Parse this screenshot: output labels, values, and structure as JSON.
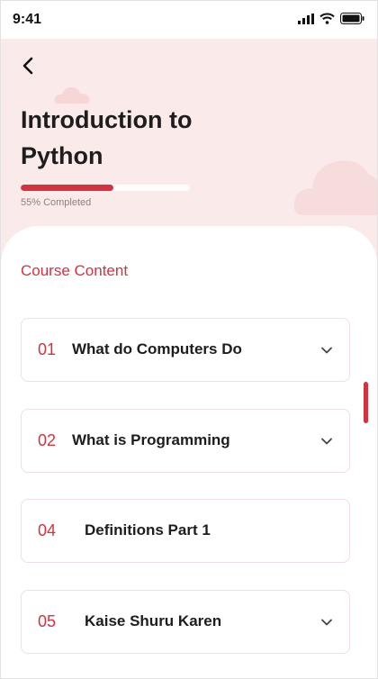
{
  "status": {
    "time": "9:41"
  },
  "course": {
    "title": "Introduction to Python",
    "progress_percent": 55,
    "progress_label": "55% Completed"
  },
  "content": {
    "section_title": "Course Content",
    "items": [
      {
        "number": "01",
        "label": "What do Computers Do",
        "expandable": true
      },
      {
        "number": "02",
        "label": "What is Programming",
        "expandable": true
      },
      {
        "number": "04",
        "label": "Definitions Part 1",
        "expandable": false
      },
      {
        "number": "05",
        "label": "Kaise Shuru Karen",
        "expandable": true
      }
    ]
  },
  "colors": {
    "accent": "#d4323f",
    "header_bg": "#fbeaea",
    "card_border": "#f1dede"
  },
  "icons": {
    "back": "chevron-left-icon",
    "expand": "chevron-down-icon"
  }
}
